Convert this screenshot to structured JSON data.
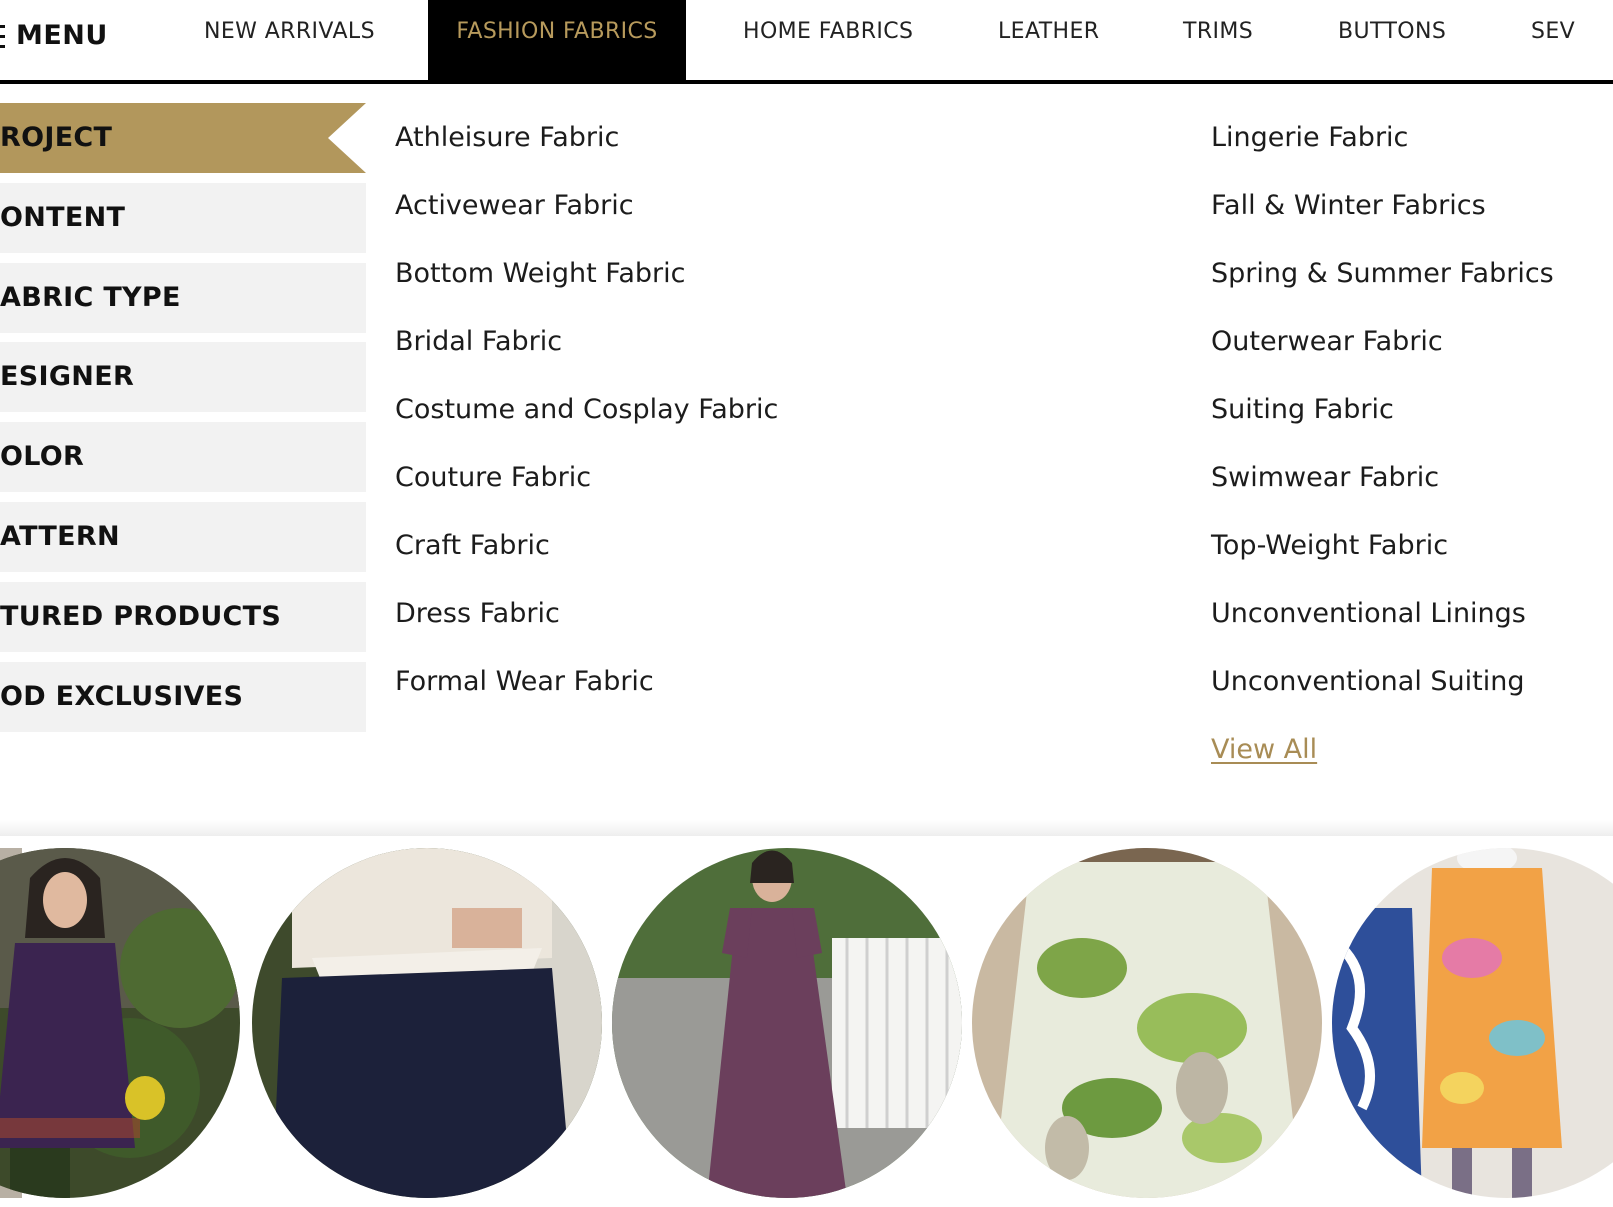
{
  "nav": {
    "menu_label": "MENU",
    "items": [
      "NEW ARRIVALS",
      "FASHION FABRICS",
      "HOME FABRICS",
      "LEATHER",
      "TRIMS",
      "BUTTONS",
      "SEV"
    ],
    "active_index": 1,
    "active_color": "#b79a5c"
  },
  "filters": {
    "items": [
      "ROJECT",
      "ONTENT",
      "ABRIC TYPE",
      "ESIGNER",
      "OLOR",
      "ATTERN",
      "TURED PRODUCTS",
      "OD EXCLUSIVES"
    ],
    "active_index": 0,
    "active_color": "#b2975c"
  },
  "submenu": {
    "column1": [
      "Athleisure Fabric",
      "Activewear Fabric",
      "Bottom Weight Fabric",
      "Bridal Fabric",
      "Costume and Cosplay Fabric",
      "Couture Fabric",
      "Craft Fabric",
      "Dress Fabric",
      "Formal Wear Fabric"
    ],
    "column2": [
      "Lingerie Fabric",
      "Fall & Winter Fabrics",
      "Spring & Summer Fabrics",
      "Outerwear Fabric",
      "Suiting Fabric",
      "Swimwear Fabric",
      "Top-Weight Fabric",
      "Unconventional Linings",
      "Unconventional Suiting"
    ],
    "view_all": "View All",
    "link_color": "#a88c55"
  },
  "gallery": {
    "photos": [
      "woman-purple-dress-photo",
      "navy-shorts-eyelet-top-photo",
      "woman-floral-maxi-dress-photo",
      "green-print-skirt-photo",
      "orange-print-shift-dress-photo"
    ]
  }
}
